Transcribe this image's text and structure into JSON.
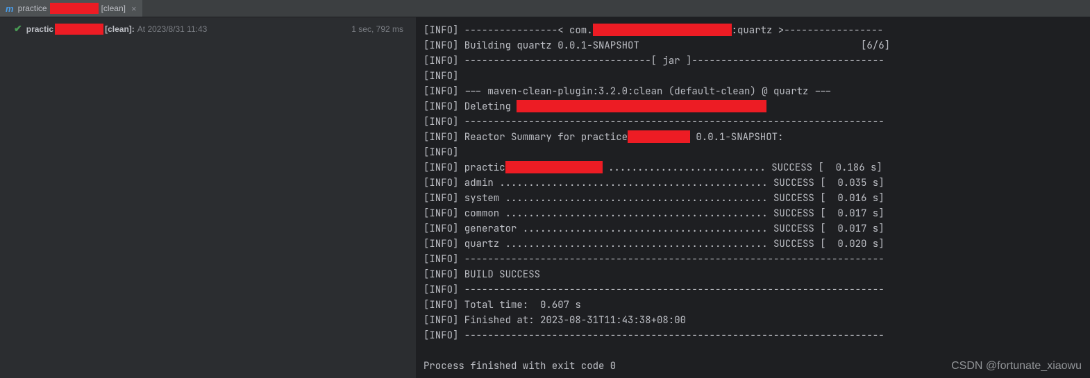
{
  "tab": {
    "icon_label": "m",
    "name_prefix": "practice",
    "goal": "[clean]",
    "close": "×"
  },
  "run_entry": {
    "status": "success",
    "name_prefix": "practic",
    "goal": "[clean]:",
    "timestamp": "At 2023/8/31 11:43",
    "duration": "1 sec, 792 ms"
  },
  "console": {
    "lines": [
      {
        "prefix": "[INFO] ----------------< com.",
        "redact_w": 200,
        "suffix": ":quartz >-----------------"
      },
      {
        "text": "[INFO] Building quartz 0.0.1-SNAPSHOT                                      [6/6]"
      },
      {
        "text": "[INFO] --------------------------------[ jar ]---------------------------------"
      },
      {
        "text": "[INFO] "
      },
      {
        "text": "[INFO] --- maven-clean-plugin:3.2.0:clean (default-clean) @ quartz ---"
      },
      {
        "prefix": "[INFO] Deleting ",
        "redact_w": 360,
        "suffix": ""
      },
      {
        "text": "[INFO] ------------------------------------------------------------------------"
      },
      {
        "prefix": "[INFO] Reactor Summary for practice",
        "redact_w": 90,
        "suffix": " 0.0.1-SNAPSHOT:"
      },
      {
        "text": "[INFO] "
      },
      {
        "prefix": "[INFO] practic",
        "redact_w": 140,
        "suffix": " ........................... SUCCESS [  0.186 s]"
      },
      {
        "text": "[INFO] admin .............................................. SUCCESS [  0.035 s]"
      },
      {
        "text": "[INFO] system ............................................. SUCCESS [  0.016 s]"
      },
      {
        "text": "[INFO] common ............................................. SUCCESS [  0.017 s]"
      },
      {
        "text": "[INFO] generator .......................................... SUCCESS [  0.017 s]"
      },
      {
        "text": "[INFO] quartz ............................................. SUCCESS [  0.020 s]"
      },
      {
        "text": "[INFO] ------------------------------------------------------------------------"
      },
      {
        "text": "[INFO] BUILD SUCCESS"
      },
      {
        "text": "[INFO] ------------------------------------------------------------------------"
      },
      {
        "text": "[INFO] Total time:  0.607 s"
      },
      {
        "text": "[INFO] Finished at: 2023-08-31T11:43:38+08:00"
      },
      {
        "text": "[INFO] ------------------------------------------------------------------------"
      },
      {
        "blank": true
      },
      {
        "text": "Process finished with exit code 0"
      }
    ]
  },
  "watermark": "CSDN @fortunate_xiaowu"
}
